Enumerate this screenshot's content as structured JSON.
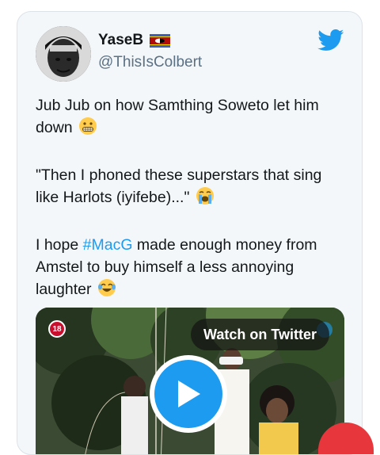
{
  "tweet": {
    "display_name": "YaseB",
    "handle": "@ThisIsColbert",
    "paragraphs": {
      "p1": {
        "text": "Jub Jub on how Samthing Soweto let him down",
        "emoji": "grimacing-face-emoji"
      },
      "p2": {
        "text": "\"Then I phoned these superstars that sing like Harlots (iyifebe)...\"",
        "emoji": "loudly-crying-face-emoji"
      },
      "p3": {
        "before": "I hope ",
        "hashtag": "#MacG",
        "after": " made enough money from Amstel to buy himself a less annoying laughter",
        "emoji": "face-with-tears-of-joy-emoji"
      }
    }
  },
  "media": {
    "age_badge": "18",
    "watch_label": "Watch on Twitter"
  },
  "icons": {
    "brand": "twitter-bird-icon",
    "flag": "eswatini-flag-icon",
    "play": "play-icon"
  },
  "colors": {
    "accent": "#1d9bf0",
    "text": "#14171a",
    "muted": "#5b7083",
    "card_bg": "#f4f7f9",
    "badge_red": "#c8102e"
  }
}
